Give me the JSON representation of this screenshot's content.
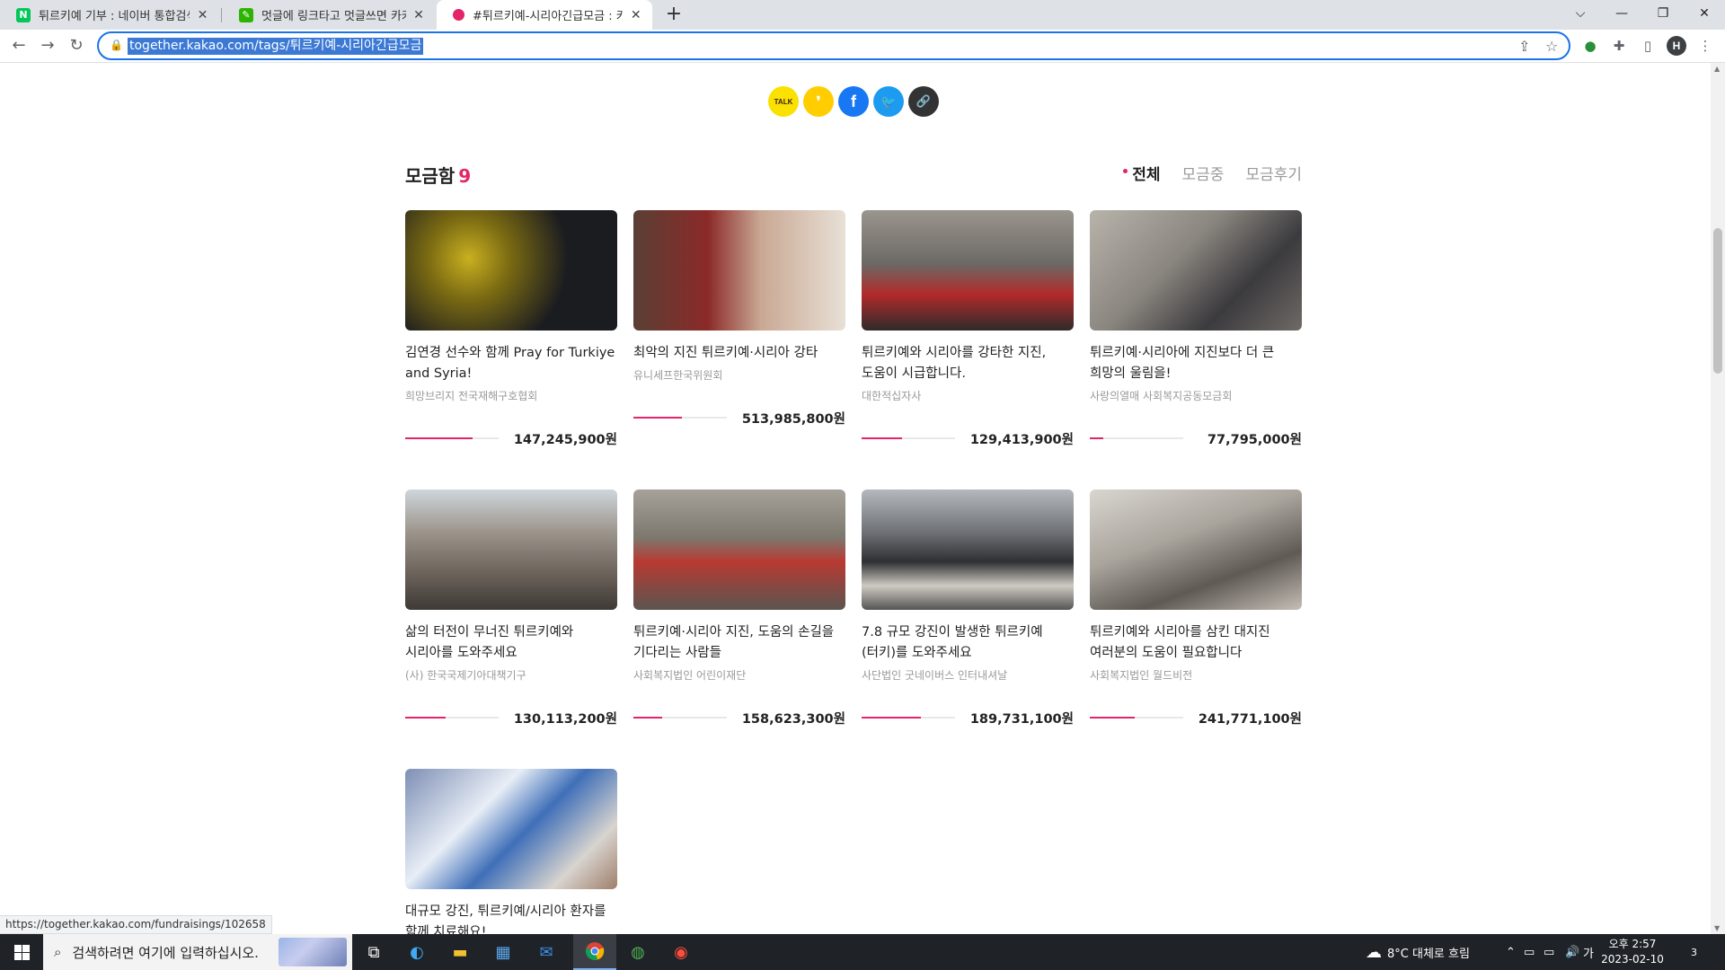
{
  "browser": {
    "tabs": [
      {
        "favicon_letter": "N",
        "favicon_color": "#03c75a",
        "title": "튀르키예 기부 : 네이버 통합검색"
      },
      {
        "favicon_letter": "✎",
        "favicon_color": "#2db400",
        "title": "멋글에 링크타고 멋글쓰면 카카오"
      },
      {
        "favicon_letter": "",
        "favicon_color": "#e3246b",
        "title": "#튀르키예-시리아긴급모금 : 카카"
      }
    ],
    "new_tab_label": "+",
    "url": "together.kakao.com/tags/튀르키예-시리아긴급모금",
    "profile_initial": "H"
  },
  "share": {
    "buttons": [
      {
        "name": "kakaotalk",
        "label": "TALK",
        "color": "#fae100",
        "text_color": "#3c1e1e"
      },
      {
        "name": "kakaostory",
        "label": "❜",
        "color": "#ffcd00",
        "text_color": "#fff"
      },
      {
        "name": "facebook",
        "label": "f",
        "color": "#1877f2",
        "text_color": "#fff"
      },
      {
        "name": "twitter",
        "label": "🐦",
        "color": "#1d9bf0",
        "text_color": "#fff"
      },
      {
        "name": "copy-link",
        "label": "🔗",
        "color": "#333333",
        "text_color": "#fff"
      }
    ]
  },
  "section": {
    "title": "모금함",
    "count": "9",
    "filters": [
      "전체",
      "모금중",
      "모금후기"
    ]
  },
  "cards": [
    {
      "title": "김연경 선수와 함께 Pray for Turkiye and Syria!",
      "org": "희망브리지 전국재해구호협회",
      "amount": "147,245,900원",
      "progress": 0.72
    },
    {
      "title": "최악의 지진 튀르키예·시리아 강타",
      "org": "유니세프한국위원회",
      "amount": "513,985,800원",
      "progress": 0.52
    },
    {
      "title": "튀르키예와 시리아를 강타한 지진, 도움이 시급합니다.",
      "org": "대한적십자사",
      "amount": "129,413,900원",
      "progress": 0.43
    },
    {
      "title": "튀르키예·시리아에 지진보다 더 큰 희망의 울림을!",
      "org": "사랑의열매 사회복지공동모금회",
      "amount": "77,795,000원",
      "progress": 0.14
    },
    {
      "title": "삶의 터전이 무너진 튀르키예와 시리아를 도와주세요",
      "org": "(사) 한국국제기아대책기구",
      "amount": "130,113,200원",
      "progress": 0.43
    },
    {
      "title": "튀르키예·시리아 지진, 도움의 손길을 기다리는 사람들",
      "org": "사회복지법인 어린이재단",
      "amount": "158,623,300원",
      "progress": 0.31
    },
    {
      "title": "7.8 규모 강진이 발생한 튀르키예(터키)를 도와주세요",
      "org": "사단법인 굿네이버스 인터내셔날",
      "amount": "189,731,100원",
      "progress": 0.63
    },
    {
      "title": "튀르키예와 시리아를 삼킨 대지진 여러분의 도움이 필요합니다",
      "org": "사회복지법인 월드비전",
      "amount": "241,771,100원",
      "progress": 0.48
    },
    {
      "title": "대규모 강진, 튀르키예/시리아 환자를 함께 치료해요!",
      "org": "",
      "amount": "",
      "progress": 0
    }
  ],
  "status_url": "https://together.kakao.com/fundraisings/102658",
  "taskbar": {
    "search_placeholder": "검색하려면 여기에 입력하십시오.",
    "weather": "8°C  대체로 흐림",
    "ime": "가",
    "time": "오후 2:57",
    "date": "2023-02-10",
    "notifications": "3"
  }
}
